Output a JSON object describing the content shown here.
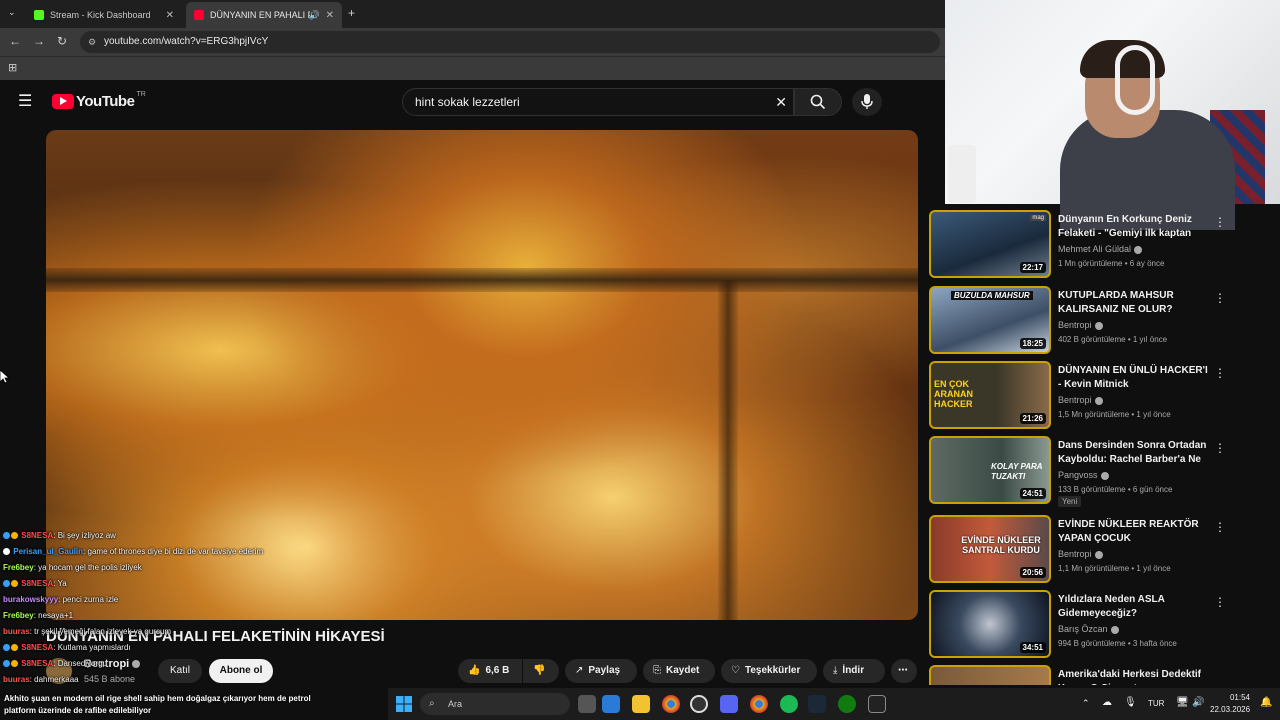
{
  "browser": {
    "tabs": [
      {
        "title": "Stream - Kick Dashboard",
        "favicon_color": "#53fc18"
      },
      {
        "title": "DÜNYANIN EN PAHALI FEL",
        "favicon_color": "#ff0033"
      }
    ],
    "url": "youtube.com/watch?v=ERG3hpjIVcY"
  },
  "youtube": {
    "logo_text": "YouTube",
    "region": "TR",
    "search_value": "hint sokak lezzetleri"
  },
  "video": {
    "title": "DÜNYANIN EN PAHALI FELAKETİNİN HİKAYESİ",
    "channel": "Bentropi",
    "subscribers": "545 B abone",
    "join_label": "Katıl",
    "subscribe_label": "Abone ol",
    "likes": "6,6 B",
    "share_label": "Paylaş",
    "save_label": "Kaydet",
    "thanks_label": "Teşekkürler",
    "download_label": "İndir"
  },
  "recommendations": [
    {
      "title": "Dünyanın En Korkunç Deniz Felaketi - \"Gemiyi ilk kaptan te...",
      "channel": "Mehmet Ali Güldal",
      "meta": "1 Mn görüntüleme • 6 ay önce",
      "duration": "22:17",
      "thumb_color": "#2a3a55",
      "thumb_tag": "mag",
      "badge": ""
    },
    {
      "title": "KUTUPLARDA MAHSUR KALIRSANIZ NE OLUR?",
      "channel": "Bentropi",
      "meta": "402 B görüntüleme • 1 yıl önce",
      "duration": "18:25",
      "thumb_color": "#5b6f8c",
      "thumb_tag": "BUZULDA MAHSUR",
      "badge": ""
    },
    {
      "title": "DÜNYANIN EN ÜNLÜ HACKER'I - Kevin Mitnick",
      "channel": "Bentropi",
      "meta": "1,5 Mn görüntüleme • 1 yıl önce",
      "duration": "21:26",
      "thumb_color": "#3c3a2c",
      "thumb_tag": "EN ÇOK ARANAN HACKER",
      "badge": ""
    },
    {
      "title": "Dans Dersinden Sonra Ortadan Kayboldu: Rachel Barber'a Ne ...",
      "channel": "Pangvoss",
      "meta": "133 B görüntüleme • 6 gün önce",
      "duration": "24:51",
      "thumb_color": "#4a5a52",
      "thumb_tag": "KOLAY PARA TUZAKTI",
      "badge": "Yeni"
    },
    {
      "title": "EVİNDE NÜKLEER REAKTÖR YAPAN ÇOCUK",
      "channel": "Bentropi",
      "meta": "1,1 Mn görüntüleme • 1 yıl önce",
      "duration": "20:56",
      "thumb_color": "#7a2a20",
      "thumb_tag": "EVİNDE NÜKLEER SANTRAL KURDU",
      "badge": ""
    },
    {
      "title": "Yıldızlara Neden ASLA Gidemeyeceğiz?",
      "channel": "Barış Özcan",
      "meta": "994 B görüntüleme • 3 hafta önce",
      "duration": "34:51",
      "thumb_color": "#1e2a3a",
      "thumb_tag": "",
      "badge": ""
    },
    {
      "title": "Amerika'daki Herkesi Dedektif Yapan O Cinayet",
      "channel": "",
      "meta": "",
      "duration": "",
      "thumb_color": "#5a4a3a",
      "thumb_tag": "",
      "badge": ""
    }
  ],
  "chat": [
    {
      "user": "S8NESA",
      "text": "Bi şey izliyoz aw",
      "color": "#ff4d4d",
      "badges": [
        "#3aa0ff",
        "#ffb000"
      ]
    },
    {
      "user": "Perisan_ul_Gaulin",
      "text": "game of thrones diye bi dizi de var tavsiye ederim",
      "color": "#3aa0ff",
      "badges": [
        "#ffffff"
      ]
    },
    {
      "user": "Fre6bey",
      "text": "ya hocam gel the polis izliyek",
      "color": "#a6ff4d",
      "badges": []
    },
    {
      "user": "S8NESA",
      "text": "Ya",
      "color": "#ff4d4d",
      "badges": [
        "#3aa0ff",
        "#ffb000"
      ]
    },
    {
      "user": "burakowskyyy",
      "text": "penci zurna izle",
      "color": "#c78cff",
      "badges": []
    },
    {
      "user": "Fre6bey",
      "text": "nesaya+1",
      "color": "#a6ff4d",
      "badges": []
    },
    {
      "user": "buuras",
      "text": "tr şekil yemeği falan izleyek ya gurcum",
      "color": "#ff5555",
      "badges": []
    },
    {
      "user": "S8NESA",
      "text": "Kutlama yapmıslardı",
      "color": "#ff4d4d",
      "badges": [
        "#3aa0ff",
        "#ffb000"
      ]
    },
    {
      "user": "S8NESA",
      "text": "Dansediyorgu",
      "color": "#ff4d4d",
      "badges": [
        "#3aa0ff",
        "#ffb000"
      ]
    },
    {
      "user": "buuras",
      "text": "dahmerkaaa",
      "color": "#ff5555",
      "badges": []
    }
  ],
  "kick_alert": {
    "line1": "Akhito şuan en modern oil rige shell sahip hem doğalgaz çıkarıyor hem de petrol",
    "line2": "platform üzerinde de rafibe edilebiliyor"
  },
  "taskbar": {
    "search_placeholder": "Ara",
    "language": "TUR",
    "time": "01:54",
    "date": "22.03.2026"
  }
}
